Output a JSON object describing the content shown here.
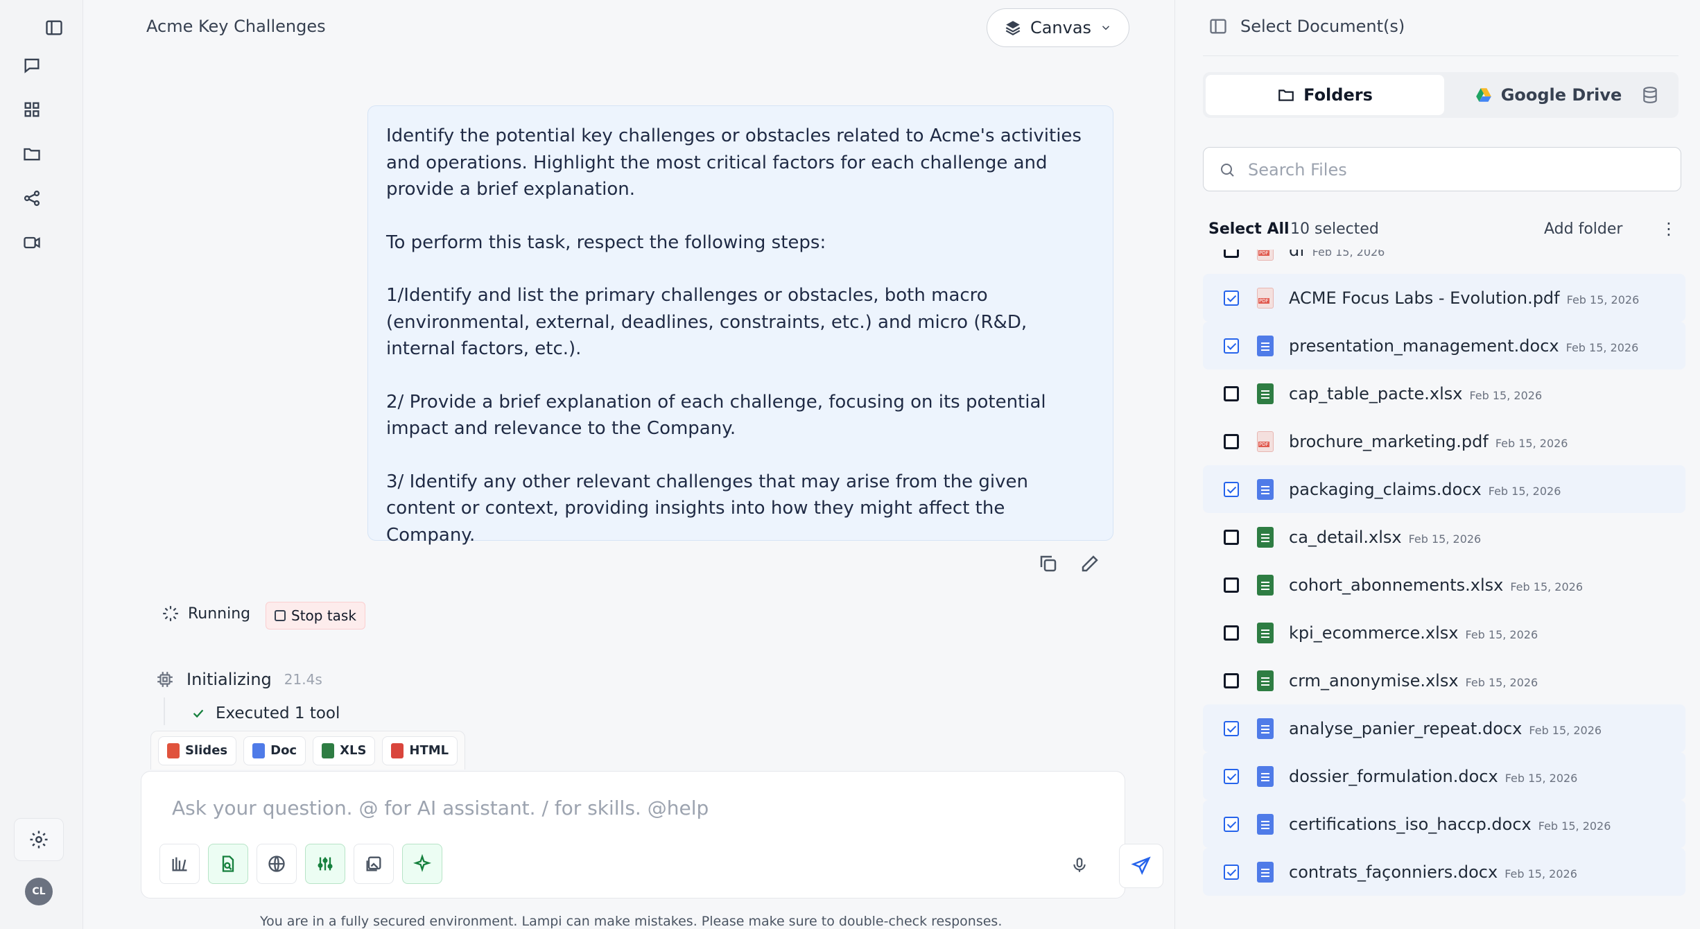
{
  "sidebar": {
    "items": [
      "toggle-panel",
      "chat",
      "apps",
      "folder",
      "share",
      "video"
    ]
  },
  "user": {
    "initials": "CL"
  },
  "header": {
    "title": "Acme Key Challenges",
    "canvas_label": "Canvas"
  },
  "message": {
    "paragraphs": [
      "Identify the potential key challenges or obstacles related to Acme's activities and operations. Highlight the most critical factors for each challenge and provide a brief explanation.",
      "To perform this task, respect the following steps:",
      "1/Identify and list the primary challenges or obstacles, both macro (environmental, external, deadlines, constraints, etc.) and micro (R&D, internal factors, etc.).",
      "2/ Provide a brief explanation of each challenge, focusing on its potential impact and relevance to the Company.",
      "3/ Identify any other relevant challenges that may arise from the given content or context, providing insights into how they might affect the Company."
    ]
  },
  "status": {
    "running_label": "Running",
    "stop_label": "Stop task",
    "init_label": "Initializing",
    "init_time": "21.4s",
    "executed_label": "Executed 1 tool"
  },
  "formats": [
    {
      "label": "Slides",
      "color": "#e0533d"
    },
    {
      "label": "Doc",
      "color": "#4f7be8"
    },
    {
      "label": "XLS",
      "color": "#2e7d43"
    },
    {
      "label": "HTML",
      "color": "#d9453c"
    }
  ],
  "composer": {
    "placeholder": "Ask your question. @ for AI assistant. / for skills. @help"
  },
  "disclaimer": "You are in a fully secured environment. Lampi can make mistakes. Please make sure to double-check responses.",
  "right_panel": {
    "title": "Select Document(s)",
    "tabs": {
      "folders": "Folders",
      "gdrive": "Google Drive"
    },
    "search_placeholder": "Search Files",
    "select_all": "Select All",
    "selected_count": "10 selected",
    "add_folder": "Add folder",
    "files": [
      {
        "name": "df",
        "date": "Feb 15, 2026",
        "type": "pdf",
        "checked": false
      },
      {
        "name": "ACME Focus Labs - Evolution.pdf",
        "date": "Feb 15, 2026",
        "type": "pdf",
        "checked": true
      },
      {
        "name": "presentation_management.docx",
        "date": "Feb 15, 2026",
        "type": "docx",
        "checked": true
      },
      {
        "name": "cap_table_pacte.xlsx",
        "date": "Feb 15, 2026",
        "type": "xlsx",
        "checked": false
      },
      {
        "name": "brochure_marketing.pdf",
        "date": "Feb 15, 2026",
        "type": "pdf",
        "checked": false
      },
      {
        "name": "packaging_claims.docx",
        "date": "Feb 15, 2026",
        "type": "docx",
        "checked": true
      },
      {
        "name": "ca_detail.xlsx",
        "date": "Feb 15, 2026",
        "type": "xlsx",
        "checked": false
      },
      {
        "name": "cohort_abonnements.xlsx",
        "date": "Feb 15, 2026",
        "type": "xlsx",
        "checked": false
      },
      {
        "name": "kpi_ecommerce.xlsx",
        "date": "Feb 15, 2026",
        "type": "xlsx",
        "checked": false
      },
      {
        "name": "crm_anonymise.xlsx",
        "date": "Feb 15, 2026",
        "type": "xlsx",
        "checked": false
      },
      {
        "name": "analyse_panier_repeat.docx",
        "date": "Feb 15, 2026",
        "type": "docx",
        "checked": true
      },
      {
        "name": "dossier_formulation.docx",
        "date": "Feb 15, 2026",
        "type": "docx",
        "checked": true
      },
      {
        "name": "certifications_iso_haccp.docx",
        "date": "Feb 15, 2026",
        "type": "docx",
        "checked": true
      },
      {
        "name": "contrats_façonniers.docx",
        "date": "Feb 15, 2026",
        "type": "docx",
        "checked": true
      }
    ]
  }
}
